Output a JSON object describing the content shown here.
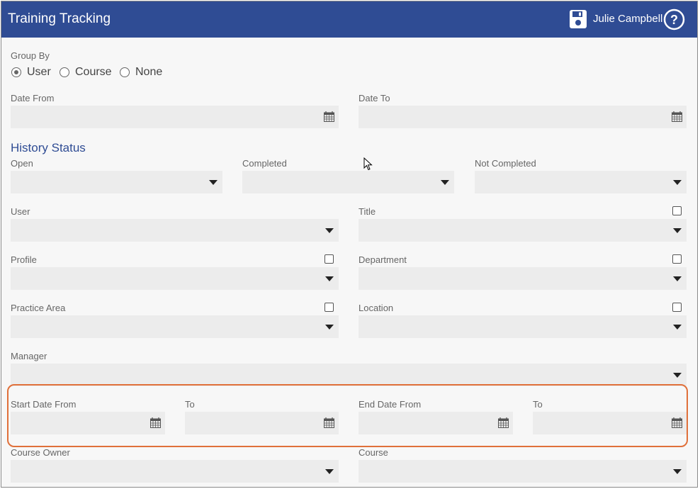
{
  "header": {
    "title": "Training Tracking",
    "user_name": "Julie Campbell",
    "bar_color": "#2f4c94",
    "icons": [
      "save-icon",
      "help-icon"
    ]
  },
  "group_by": {
    "label": "Group By",
    "options": [
      "User",
      "Course",
      "None"
    ],
    "selected": "User"
  },
  "dates": {
    "date_from_label": "Date From",
    "date_to_label": "Date To"
  },
  "history_status": {
    "title": "History Status",
    "open_label": "Open",
    "completed_label": "Completed",
    "not_completed_label": "Not Completed"
  },
  "filters": {
    "user_label": "User",
    "title_label": "Title",
    "profile_label": "Profile",
    "department_label": "Department",
    "practice_area_label": "Practice Area",
    "location_label": "Location",
    "manager_label": "Manager"
  },
  "course_dates": {
    "start_date_from_label": "Start Date From",
    "start_to_label": "To",
    "end_date_from_label": "End Date From",
    "end_to_label": "To",
    "highlight_color": "#e0703a"
  },
  "course_filters": {
    "course_owner_label": "Course Owner",
    "course_label": "Course"
  }
}
